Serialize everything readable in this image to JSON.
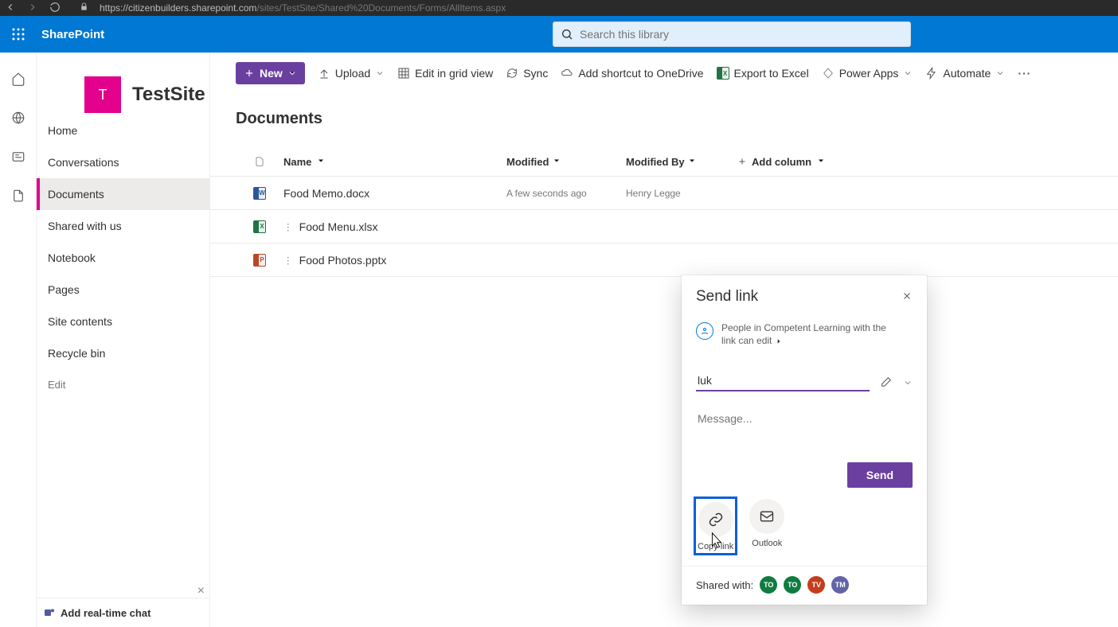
{
  "browser": {
    "url_light": "https://citizenbuilders.sharepoint.com",
    "url_dark": "/sites/TestSite/Shared%20Documents/Forms/AllItems.aspx"
  },
  "header": {
    "brand": "SharePoint",
    "search_placeholder": "Search this library"
  },
  "site": {
    "logo_letter": "T",
    "title": "TestSite"
  },
  "sidebar": {
    "items": [
      {
        "label": "Home"
      },
      {
        "label": "Conversations"
      },
      {
        "label": "Documents",
        "active": true
      },
      {
        "label": "Shared with us"
      },
      {
        "label": "Notebook"
      },
      {
        "label": "Pages"
      },
      {
        "label": "Site contents"
      },
      {
        "label": "Recycle bin"
      }
    ],
    "edit_label": "Edit",
    "rtc_label": "Add real-time chat"
  },
  "toolbar": {
    "new_label": "New",
    "upload_label": "Upload",
    "grid_label": "Edit in grid view",
    "sync_label": "Sync",
    "shortcut_label": "Add shortcut to OneDrive",
    "export_label": "Export to Excel",
    "powerapps_label": "Power Apps",
    "automate_label": "Automate"
  },
  "library": {
    "title": "Documents",
    "columns": {
      "name": "Name",
      "modified": "Modified",
      "modified_by": "Modified By",
      "add_column": "Add column"
    },
    "rows": [
      {
        "name": "Food Memo.docx",
        "type": "word",
        "modified": "A few seconds ago",
        "modified_by": "Henry Legge"
      },
      {
        "name": "Food Menu.xlsx",
        "type": "excel",
        "modified": "",
        "modified_by": ""
      },
      {
        "name": "Food Photos.pptx",
        "type": "ppt",
        "modified": "",
        "modified_by": ""
      }
    ]
  },
  "dialog": {
    "title": "Send link",
    "scope_text": "People in Competent Learning with the link can edit",
    "recipient_value": "luk",
    "message_placeholder": "Message...",
    "send_label": "Send",
    "apps": {
      "copy_link": "Copy link",
      "outlook": "Outlook"
    },
    "shared_with_label": "Shared with:",
    "avatars": [
      {
        "initials": "TO",
        "color": "green"
      },
      {
        "initials": "TO",
        "color": "green"
      },
      {
        "initials": "TV",
        "color": "red"
      },
      {
        "initials": "TM",
        "color": "blue"
      }
    ]
  }
}
